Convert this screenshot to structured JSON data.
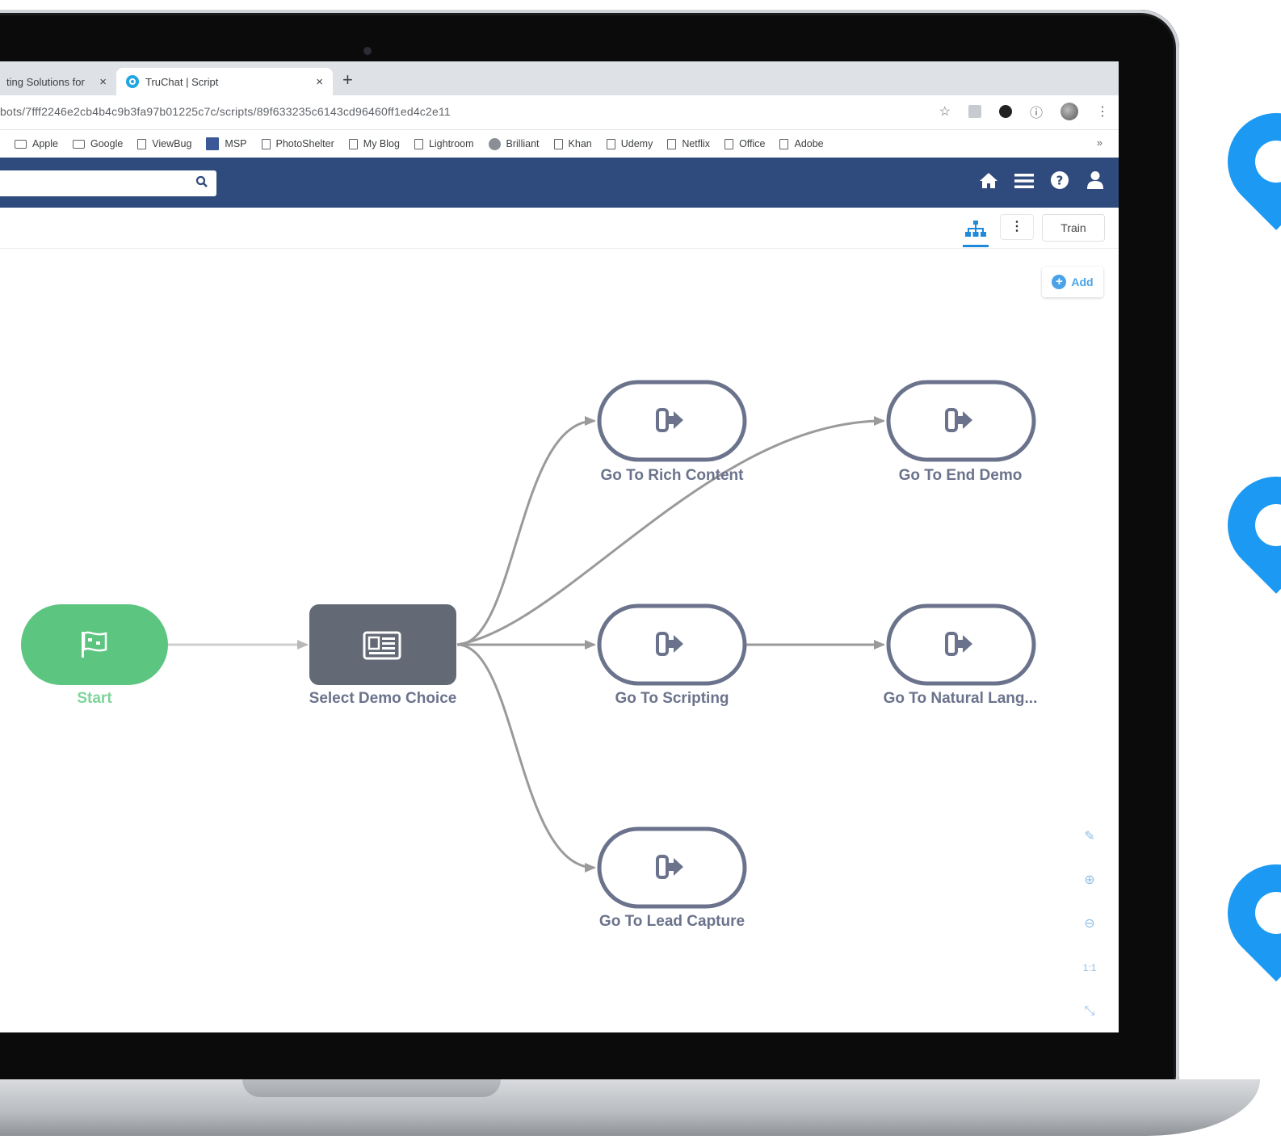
{
  "browser": {
    "tabs": [
      {
        "title": "ting Solutions for",
        "close": "×"
      },
      {
        "title": "TruChat | Script",
        "close": "×"
      }
    ],
    "new_tab": "+",
    "url": "bots/7fff2246e2cb4b4c9b3fa97b01225c7c/scripts/89f633235c6143cd96460ff1ed4c2e11",
    "bookmarks": [
      "Apple",
      "Google",
      "ViewBug",
      "MSP",
      "PhotoShelter",
      "My Blog",
      "Lightroom",
      "Brilliant",
      "Khan",
      "Udemy",
      "Netflix",
      "Office",
      "Adobe"
    ],
    "bookmarks_more": "»",
    "icons": {
      "star": "☆",
      "info": "ⓘ",
      "menu": "⋮"
    }
  },
  "app": {
    "header_icons": {
      "home": "⌂",
      "menu": "≡",
      "help": "?",
      "user": "●"
    },
    "toolbar": {
      "more": "⋮",
      "train": "Train"
    },
    "add_label": "Add",
    "zoom": {
      "edit": "✎",
      "zoom_in": "⊕",
      "zoom_out": "⊖",
      "actual": "1:1",
      "fit": "⤡"
    }
  },
  "flow": {
    "nodes": {
      "start": "Start",
      "select": "Select Demo Choice",
      "rich": "Go To Rich Content",
      "scripting": "Go To Scripting",
      "lead": "Go To Lead Capture",
      "end": "Go To End Demo",
      "natural": "Go To Natural Lang..."
    },
    "colors": {
      "start_fill": "#5cc580",
      "select_fill": "#636a75",
      "node_border": "#6b738c",
      "edge": "#9a9a9a"
    }
  }
}
